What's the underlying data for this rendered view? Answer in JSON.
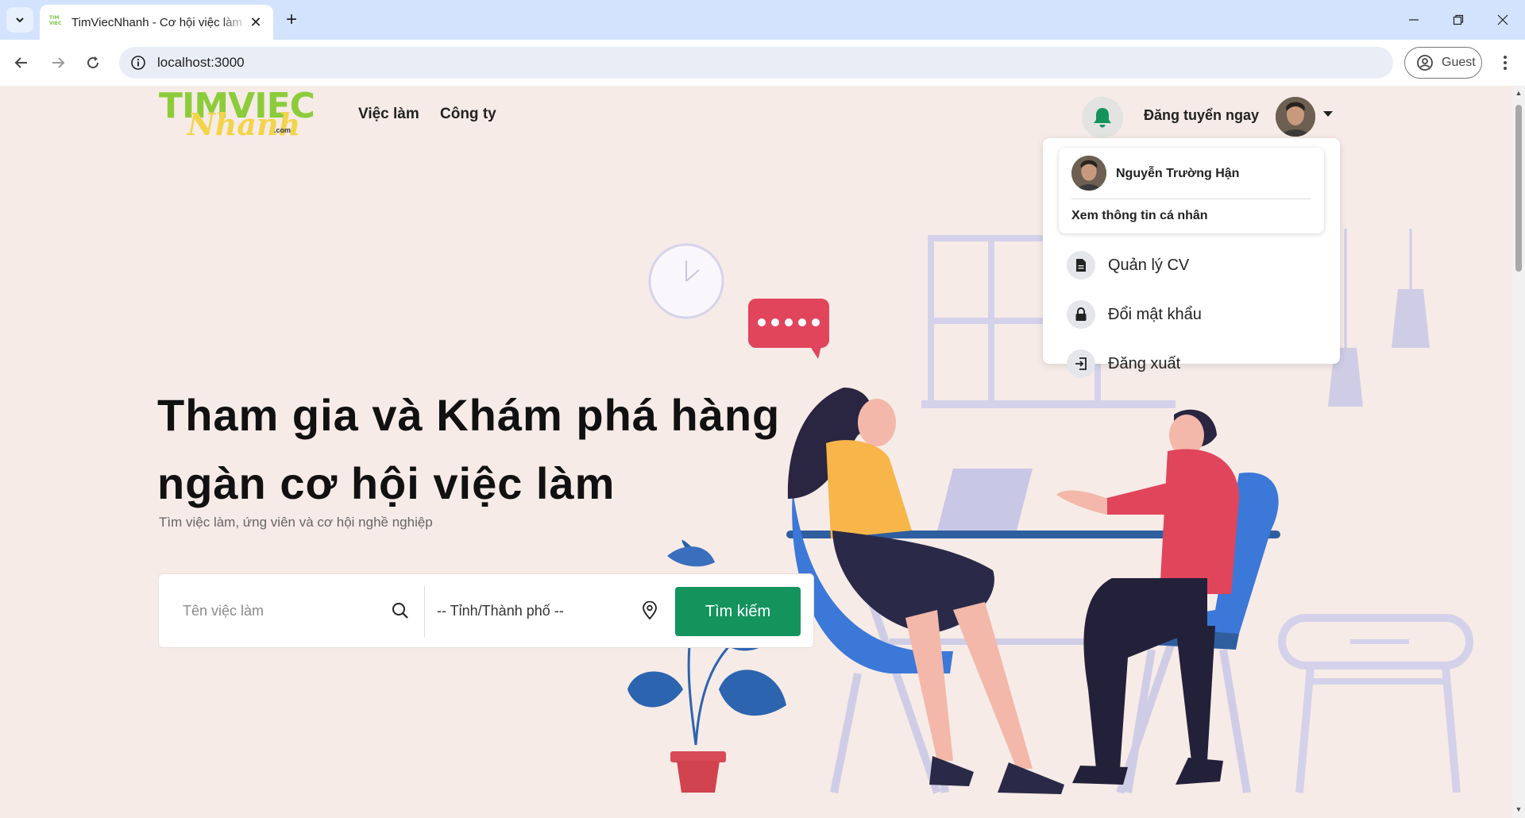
{
  "browser": {
    "tab_title": "TimViecNhanh - Cơ hội việc làm",
    "url": "localhost:3000",
    "profile_label": "Guest"
  },
  "header": {
    "logo_top": "TIMVIEC",
    "logo_script": "Nhanh",
    "logo_suffix": ".com",
    "nav": [
      "Việc làm",
      "Công ty"
    ],
    "post_job_label": "Đăng tuyển ngay"
  },
  "user_menu": {
    "name": "Nguyễn Trường Hận",
    "profile_link": "Xem thông tin cá nhân",
    "items": [
      {
        "label": "Quản lý CV",
        "icon": "file-icon"
      },
      {
        "label": "Đổi mật khẩu",
        "icon": "lock-icon"
      },
      {
        "label": "Đăng xuất",
        "icon": "logout-icon"
      }
    ]
  },
  "hero": {
    "title": "Tham gia và Khám phá hàng ngàn cơ hội việc làm",
    "subtitle": "Tìm việc làm, ứng viên và cơ hội nghề nghiệp"
  },
  "search": {
    "job_placeholder": "Tên việc làm",
    "city_value": "-- Tỉnh/Thành phố --",
    "button_label": "Tìm kiếm"
  },
  "colors": {
    "accent": "#14935d",
    "page_bg": "#f6ebe7",
    "bell": "#14935d"
  }
}
